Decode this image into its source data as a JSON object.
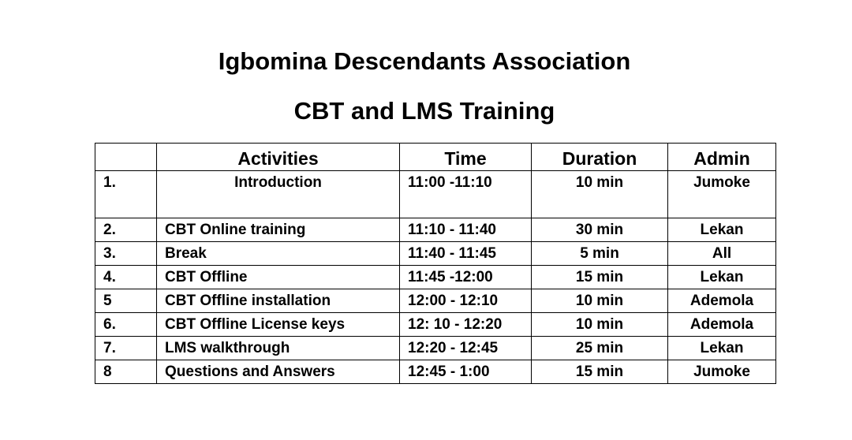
{
  "header": {
    "title": "Igbomina Descendants Association",
    "subtitle": "CBT and LMS Training"
  },
  "table": {
    "columns": [
      "",
      "Activities",
      "Time",
      "Duration",
      "Admin"
    ],
    "rows": [
      {
        "num": "1.",
        "activity": "Introduction",
        "time": "11:00 -11:10",
        "duration": "10 min",
        "admin": "Jumoke"
      },
      {
        "num": "2.",
        "activity": "CBT Online training",
        "time": "11:10 - 11:40",
        "duration": "30 min",
        "admin": "Lekan"
      },
      {
        "num": "3.",
        "activity": "Break",
        "time": "11:40 - 11:45",
        "duration": "5 min",
        "admin": "All"
      },
      {
        "num": "4.",
        "activity": "CBT Offline",
        "time": "11:45 -12:00",
        "duration": "15 min",
        "admin": "Lekan"
      },
      {
        "num": "5",
        "activity": "CBT Offline installation",
        "time": "12:00 - 12:10",
        "duration": "10 min",
        "admin": "Ademola"
      },
      {
        "num": "6.",
        "activity": "CBT Offline License keys",
        "time": "12: 10 - 12:20",
        "duration": "10 min",
        "admin": "Ademola"
      },
      {
        "num": "7.",
        "activity": "LMS walkthrough",
        "time": "12:20 - 12:45",
        "duration": "25 min",
        "admin": "Lekan"
      },
      {
        "num": "8",
        "activity": "Questions and Answers",
        "time": "12:45 - 1:00",
        "duration": "15 min",
        "admin": "Jumoke"
      }
    ]
  }
}
